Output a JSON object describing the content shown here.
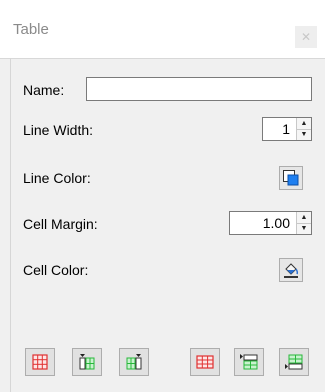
{
  "panel": {
    "title": "Table",
    "close_icon": "close-icon"
  },
  "fields": {
    "name_label": "Name:",
    "name_value": "",
    "line_width_label": "Line Width:",
    "line_width_value": "1",
    "line_color_label": "Line Color:",
    "cell_margin_label": "Cell Margin:",
    "cell_margin_value": "1.00",
    "cell_color_label": "Cell Color:"
  },
  "colors": {
    "line_color_swatch": "#1e7ff0",
    "red_grid": "#e03030",
    "green_grid": "#27b83a"
  },
  "toolbar": {
    "icons": [
      "delete-table-icon",
      "insert-column-before-icon",
      "insert-column-after-icon",
      "delete-row-icon",
      "insert-row-before-icon",
      "insert-row-after-icon"
    ]
  }
}
